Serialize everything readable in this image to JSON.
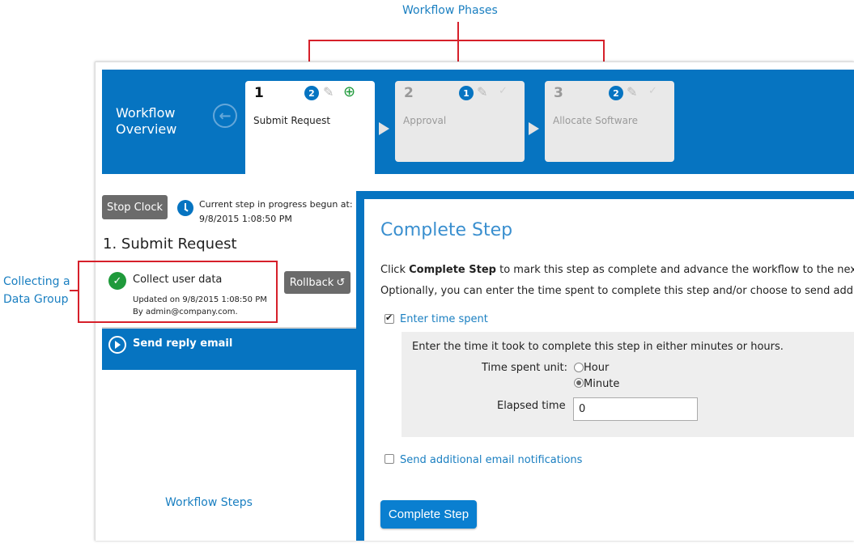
{
  "annotations": {
    "phases": "Workflow Phases",
    "group_line1": "Collecting a",
    "group_line2": "Data Group",
    "steps": "Workflow Steps"
  },
  "header": {
    "title_line1": "Workflow",
    "title_line2": "Overview"
  },
  "phases": [
    {
      "number": "1",
      "name": "Submit Request",
      "badge": "2",
      "active": true
    },
    {
      "number": "2",
      "name": "Approval",
      "badge": "1",
      "active": false
    },
    {
      "number": "3",
      "name": "Allocate Software",
      "badge": "2",
      "active": false
    }
  ],
  "left_panel": {
    "stop_clock_label": "Stop Clock",
    "current_step_line1": "Current step in progress begun at:",
    "current_step_line2": "9/8/2015 1:08:50 PM",
    "step_title": "1. Submit Request",
    "task": {
      "name": "Collect user data",
      "updated": "Updated on 9/8/2015 1:08:50 PM",
      "by": "By admin@company.com."
    },
    "rollback_label": "Rollback",
    "next_task": "Send reply email"
  },
  "main": {
    "title": "Complete Step",
    "line1_pre": "Click ",
    "line1_bold": "Complete Step",
    "line1_post": " to mark this step as complete and advance the workflow to the next step.",
    "line2": "Optionally, you can enter the time spent to complete this step and/or choose to send additional e",
    "enter_time_label": "Enter time spent",
    "time_intro": "Enter the time it took to complete this step in either minutes or hours.",
    "time_unit_label": "Time spent unit:",
    "unit_options": [
      "Hour",
      "Minute"
    ],
    "unit_selected": "Minute",
    "elapsed_label": "Elapsed time",
    "elapsed_value": "0",
    "send_email_label": "Send additional email notifications",
    "complete_button": "Complete Step"
  },
  "colors": {
    "primary_blue": "#0674c1",
    "annotation_red": "#d6202a",
    "success_green": "#1f9a3b",
    "button_gray": "#6b6b6b"
  }
}
